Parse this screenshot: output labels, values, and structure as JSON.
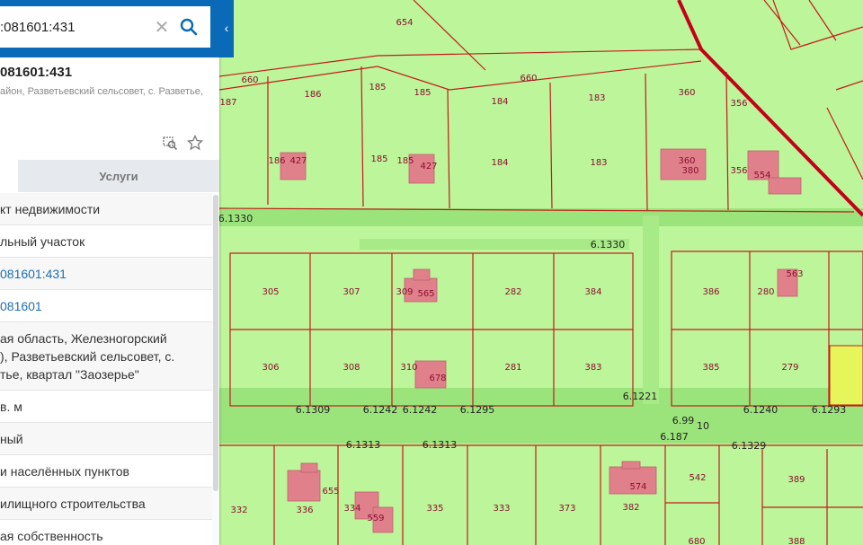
{
  "search": {
    "value": ":081601:431",
    "clear_icon": "close-icon",
    "search_icon": "search-icon"
  },
  "panel": {
    "title": "081601:431",
    "subtitle": "айон, Разветьевский сельсовет, с. Разветье,",
    "collapse_icon": "chevron-left-icon",
    "tabs": [
      {
        "label": ""
      },
      {
        "label": "Услуги"
      }
    ],
    "rows": [
      {
        "text": "кт недвижимости",
        "link": false
      },
      {
        "text": "льный участок",
        "link": false
      },
      {
        "text": "081601:431",
        "link": true
      },
      {
        "text": "081601",
        "link": true
      },
      {
        "text": "ая область, Железногорский\n), Разветьевский сельсовет, с.\nтье, квартал \"Заозерье\"",
        "link": false
      },
      {
        "text": "в. м",
        "link": false
      },
      {
        "text": "ный",
        "link": false
      },
      {
        "text": "и населённых пунктов",
        "link": false
      },
      {
        "text": "илищного строительства",
        "link": false
      },
      {
        "text": "ая собственность",
        "link": false
      }
    ]
  },
  "map": {
    "colors": {
      "parcel_fill": "#bdf59a",
      "road_fill": "#9be47c",
      "parcel_line": "#c41a1a",
      "building": "#e0808a",
      "selected": "#e5f55a",
      "boundary": "#c4001a"
    },
    "parcel_labels": [
      "660",
      "186",
      "185",
      "185",
      "184",
      "183",
      "360",
      "356",
      "187",
      "654",
      "660",
      "186",
      "427",
      "185",
      "185",
      "427",
      "184",
      "183",
      "360",
      "380",
      "356",
      "554",
      "305",
      "307",
      "309",
      "565",
      "282",
      "384",
      "386",
      "280",
      "563",
      "306",
      "308",
      "310",
      "678",
      "281",
      "383",
      "385",
      "279",
      "332",
      "336",
      "655",
      "334",
      "559",
      "335",
      "333",
      "373",
      "382",
      "574",
      "542",
      "389",
      "680",
      "388"
    ],
    "road_labels": [
      "6.1330",
      "6.1330",
      "6.1221",
      "6.1309",
      "6.1242",
      "6.1242",
      "6.1295",
      "6.99",
      "10",
      "6.1240",
      "6.1293",
      "6.187",
      "6.1313",
      "6.1313",
      "6.1329"
    ]
  }
}
